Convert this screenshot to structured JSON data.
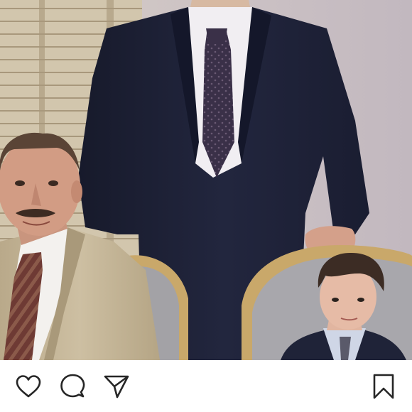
{
  "post": {
    "photo": {
      "kind": "vintage family portrait photograph"
    },
    "actions": [
      {
        "icon": "heart-icon",
        "name": "like"
      },
      {
        "icon": "comment-bubble-icon",
        "name": "comment"
      },
      {
        "icon": "paper-plane-icon",
        "name": "share"
      },
      {
        "icon": "bookmark-icon",
        "name": "save"
      }
    ]
  },
  "colors": {
    "background": "#ffffff",
    "icon_stroke": "#262626",
    "wall": "#c9c0c4",
    "shutter": "#cfc2a8",
    "suit_dark": "#1e2238",
    "suit_tan": "#c8b99a",
    "chair_frame": "#c9a86a"
  }
}
